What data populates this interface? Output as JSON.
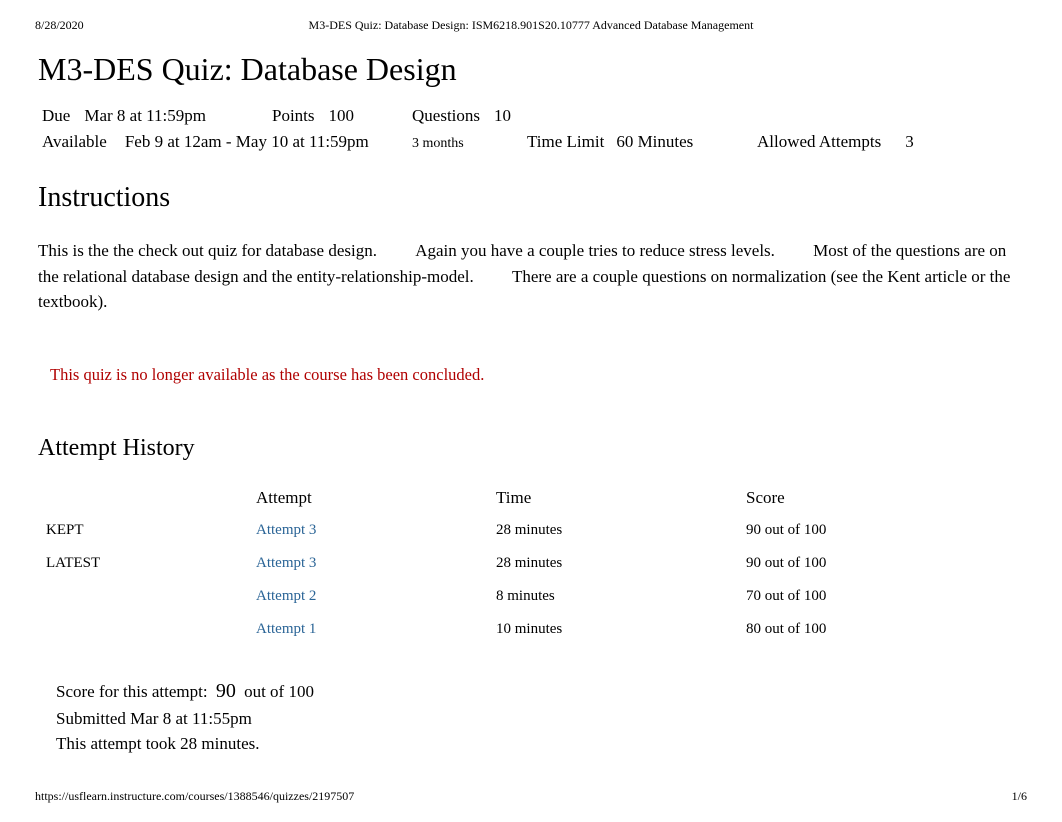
{
  "header": {
    "date": "8/28/2020",
    "title_long": "M3-DES Quiz: Database Design: ISM6218.901S20.10777 Advanced Database Management"
  },
  "page_title": "M3-DES Quiz: Database Design",
  "meta": {
    "due_label": "Due",
    "due_value": "Mar 8 at 11:59pm",
    "points_label": "Points",
    "points_value": "100",
    "questions_label": "Questions",
    "questions_value": "10",
    "available_label": "Available",
    "available_value": "Feb 9 at 12am - May 10 at 11:59pm",
    "duration_note": "3 months",
    "time_limit_label": "Time Limit",
    "time_limit_value": "60 Minutes",
    "allowed_label": "Allowed Attempts",
    "allowed_value": "3"
  },
  "instructions": {
    "heading": "Instructions",
    "body": "This is the the check out quiz for database design.         Again you have a couple tries to reduce stress levels.         Most of the questions are on the relational database design and the entity-relationship-model.         There are a couple questions on normalization (see the Kent article or the textbook)."
  },
  "notice": "This quiz is no longer available as the course has been concluded.",
  "history": {
    "heading": "Attempt History",
    "columns": {
      "tag": "",
      "attempt": "Attempt",
      "time": "Time",
      "score": "Score"
    },
    "rows": [
      {
        "tag": "KEPT",
        "attempt": "Attempt 3",
        "time": "28 minutes",
        "score": "90 out of 100"
      },
      {
        "tag": "LATEST",
        "attempt": "Attempt 3",
        "time": "28 minutes",
        "score": "90 out of 100"
      },
      {
        "tag": "",
        "attempt": "Attempt 2",
        "time": "8 minutes",
        "score": "70 out of 100"
      },
      {
        "tag": "",
        "attempt": "Attempt 1",
        "time": "10 minutes",
        "score": "80 out of 100"
      }
    ]
  },
  "score_summary": {
    "label": "Score for this attempt:",
    "score": "90",
    "suffix": "out of 100",
    "submitted": "Submitted Mar 8 at 11:55pm",
    "took": "This attempt took 28 minutes."
  },
  "footer": {
    "url": "https://usflearn.instructure.com/courses/1388546/quizzes/2197507",
    "page": "1/6"
  }
}
